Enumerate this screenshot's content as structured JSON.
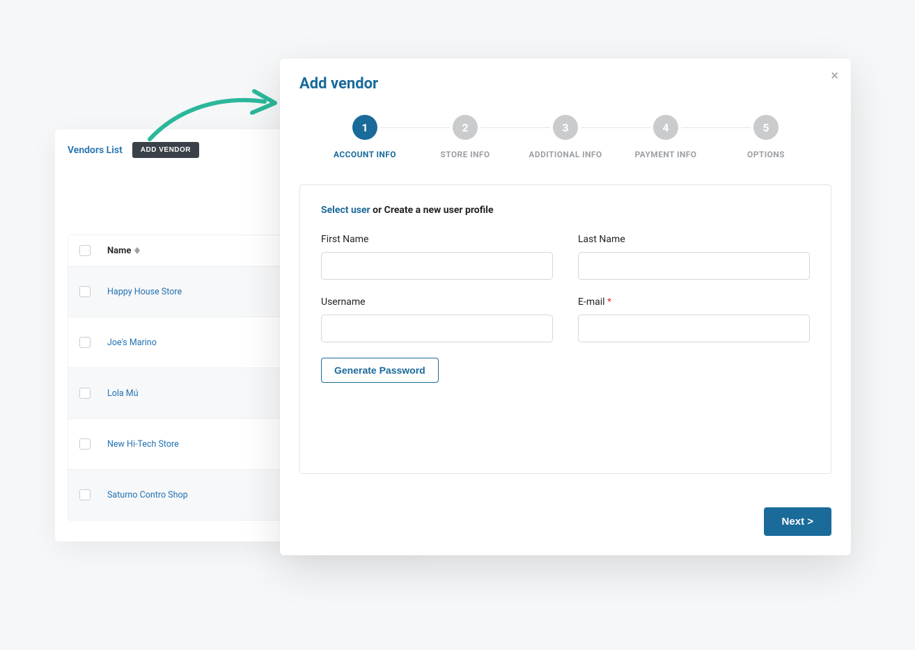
{
  "vendors_panel": {
    "title": "Vendors List",
    "add_button": "ADD VENDOR",
    "name_header": "Name",
    "rows": [
      "Happy House Store",
      "Joe's Marino",
      "Lola Mú",
      "New Hi-Tech Store",
      "Saturno Contro Shop"
    ]
  },
  "modal": {
    "title": "Add vendor",
    "close_label": "×",
    "steps": [
      {
        "num": "1",
        "label": "ACCOUNT INFO",
        "active": true
      },
      {
        "num": "2",
        "label": "STORE INFO",
        "active": false
      },
      {
        "num": "3",
        "label": "ADDITIONAL INFO",
        "active": false
      },
      {
        "num": "4",
        "label": "PAYMENT INFO",
        "active": false
      },
      {
        "num": "5",
        "label": "OPTIONS",
        "active": false
      }
    ],
    "intro_select": "Select user",
    "intro_rest": " or Create a new user profile",
    "fields": {
      "first_name_label": "First Name",
      "last_name_label": "Last Name",
      "username_label": "Username",
      "email_label": "E-mail ",
      "required_mark": "*"
    },
    "generate_password": "Generate Password",
    "next_button": "Next >"
  }
}
